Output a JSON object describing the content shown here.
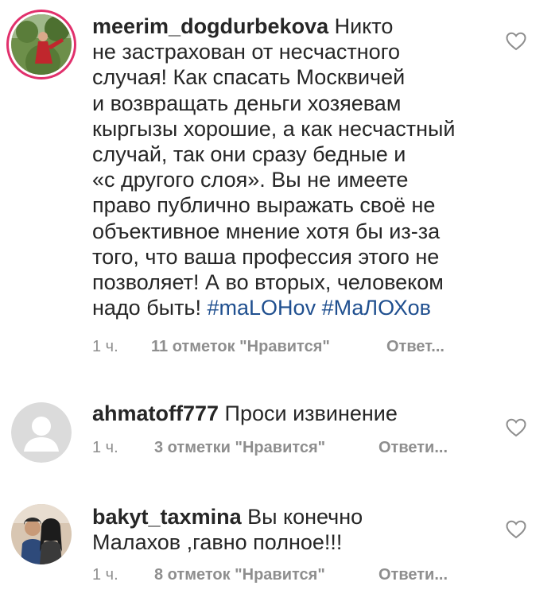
{
  "comments": [
    {
      "username": "meerim_dogdurbekova",
      "text_lines": [
        " Никто",
        "не застрахован от несчастного",
        "случая! Как спасать Москвичей",
        "и возвращать деньги хозяевам",
        "кыргызы хорошие, а как несчастный",
        "случай, так они сразу бедные и",
        "«с другого слоя». Вы не имеете",
        "право публично выражать своё не",
        "объективное  мнение хотя бы из-за",
        "того, что ваша профессия этого не",
        "позволяет! А во вторых, человеком",
        "надо быть! "
      ],
      "hashtag1": "#maLOHov",
      "hashtag2": "#МаЛОХов",
      "time": "1 ч.",
      "likes": "11 отметок \"Нравится\"",
      "reply": "Ответ..."
    },
    {
      "username": "ahmatoff777",
      "text": " Проси извинение",
      "time": "1 ч.",
      "likes": "3 отметки \"Нравится\"",
      "reply": "Ответи..."
    },
    {
      "username": "bakyt_taxmina",
      "text_line1": " Вы конечно",
      "text_line2": "Малахов ,гавно полное!!!",
      "time": "1 ч.",
      "likes": "8 отметок \"Нравится\"",
      "reply": "Ответи..."
    }
  ],
  "icons": {
    "like": "heart-outline-icon",
    "default_avatar": "default-avatar-icon"
  },
  "colors": {
    "text": "#262626",
    "meta": "#8e8e8e",
    "hashtag": "#1f4f8f",
    "story_ring": "#e1306c"
  }
}
